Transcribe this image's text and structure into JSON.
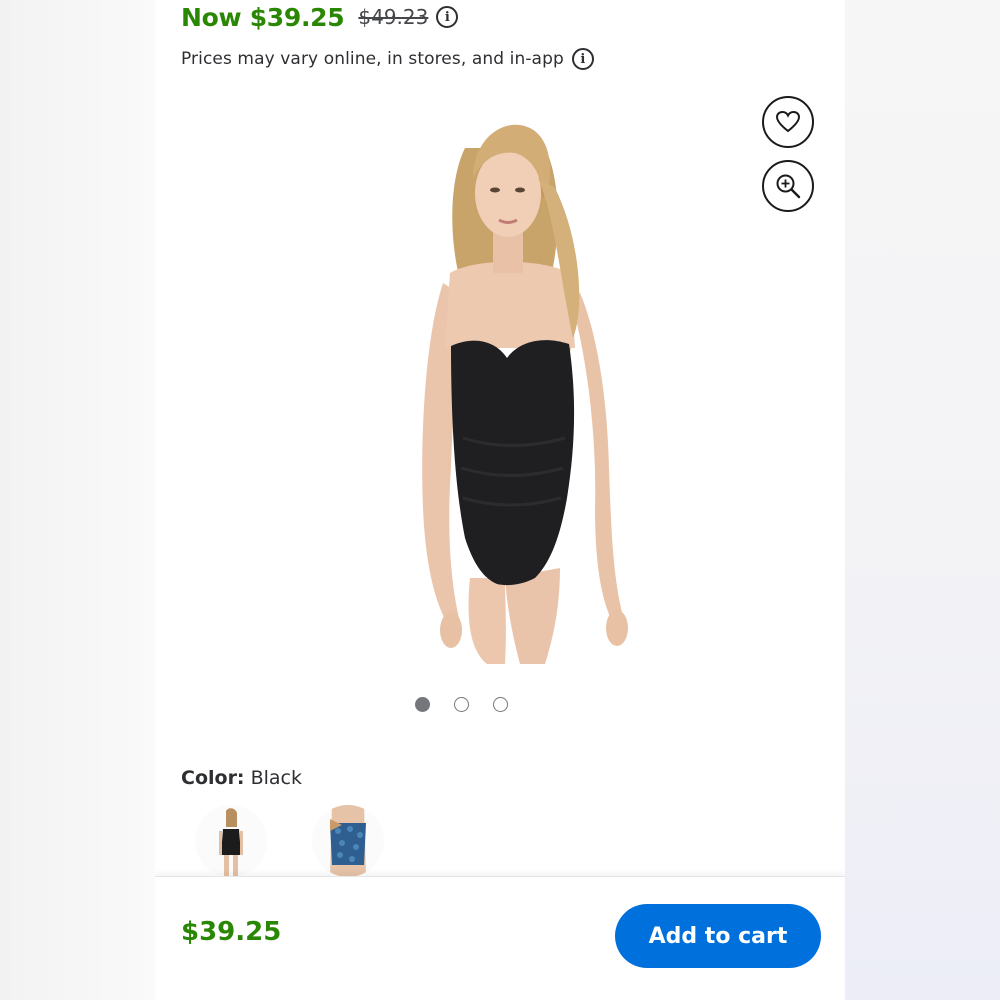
{
  "price": {
    "now": "Now $39.25",
    "was": "$49.23",
    "info_icon": "info-icon"
  },
  "notice": {
    "text": "Prices may vary online, in stores, and in-app",
    "info_icon": "info-icon"
  },
  "gallery": {
    "image": "model wearing black strapless one-piece swimsuit",
    "favorite_icon": "heart-icon",
    "zoom_icon": "zoom-in-icon",
    "dots_count": 3,
    "active_index": 0
  },
  "color": {
    "label": "Color:",
    "value": "Black",
    "swatches": [
      "Black",
      "Blue print"
    ]
  },
  "bottom_bar": {
    "price": "$39.25",
    "add_to_cart": "Add to cart"
  },
  "colors": {
    "price_green": "#2a8703",
    "primary_blue": "#0071dc"
  }
}
